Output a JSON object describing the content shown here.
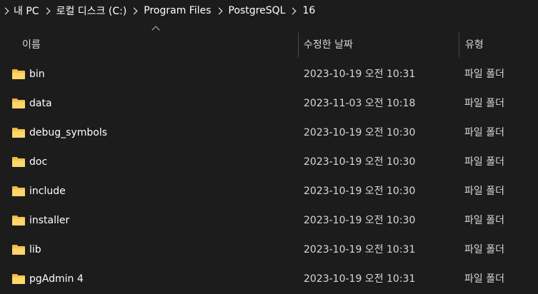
{
  "breadcrumb": {
    "items": [
      "내 PC",
      "로컬 디스크 (C:)",
      "Program Files",
      "PostgreSQL",
      "16"
    ]
  },
  "columns": {
    "name": "이름",
    "date": "수정한 날짜",
    "type": "유형"
  },
  "files": [
    {
      "name": "bin",
      "date": "2023-10-19 오전 10:31",
      "type": "파일 폴더"
    },
    {
      "name": "data",
      "date": "2023-11-03 오전 10:18",
      "type": "파일 폴더"
    },
    {
      "name": "debug_symbols",
      "date": "2023-10-19 오전 10:30",
      "type": "파일 폴더"
    },
    {
      "name": "doc",
      "date": "2023-10-19 오전 10:30",
      "type": "파일 폴더"
    },
    {
      "name": "include",
      "date": "2023-10-19 오전 10:30",
      "type": "파일 폴더"
    },
    {
      "name": "installer",
      "date": "2023-10-19 오전 10:30",
      "type": "파일 폴더"
    },
    {
      "name": "lib",
      "date": "2023-10-19 오전 10:31",
      "type": "파일 폴더"
    },
    {
      "name": "pgAdmin 4",
      "date": "2023-10-19 오전 10:31",
      "type": "파일 폴더"
    }
  ],
  "icons": {
    "folder": "folder-icon",
    "separator": "chevron-right-icon",
    "sort": "chevron-up-icon"
  },
  "colors": {
    "background": "#1c1c1c",
    "folder": "#f3c54e",
    "text": "#ffffff",
    "secondary_text": "#d8d8d8"
  }
}
